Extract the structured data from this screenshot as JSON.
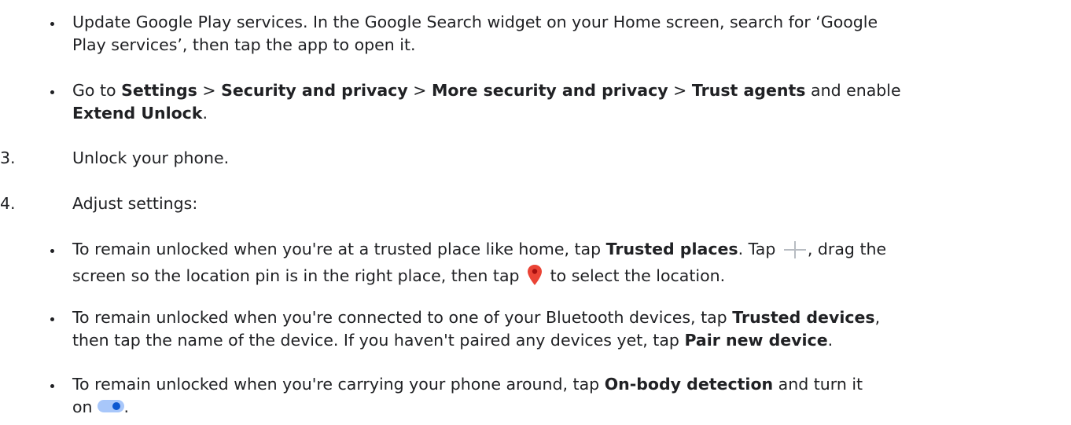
{
  "items": [
    {
      "type": "bullet",
      "lines": [
        "Update Google Play services. In the Google Search widget on your Home screen, search for ‘Google",
        "Play services’, then tap the app to open it."
      ]
    },
    {
      "type": "bullet",
      "settings_intro": "Go to",
      "settings": "Settings",
      "sep": ">",
      "security": "Security and privacy",
      "more_security": "More security and privacy",
      "trust_agents": "Trust agents",
      "and_enable": "and enable",
      "extend_unlock": "Extend Unlock",
      "period": "."
    },
    {
      "type": "numbered",
      "number": "3.",
      "text": "Unlock your phone."
    },
    {
      "type": "numbered",
      "number": "4.",
      "text": "Adjust settings:"
    },
    {
      "type": "bullet",
      "line1_pre": "To remain unlocked when you're at a trusted place like home, tap",
      "trusted_places": "Trusted places",
      "line1_mid": ". Tap",
      "line1_post": ", drag the",
      "line2_pre": "screen so the location pin is in the right place, then tap",
      "line2_post": "to select the location.",
      "icons": [
        "add-icon",
        "location-pin-icon"
      ]
    },
    {
      "type": "bullet",
      "line1_pre": "To remain unlocked when you're connected to one of your Bluetooth devices, tap",
      "trusted_devices": "Trusted devices",
      "comma": ",",
      "line2_pre": "then tap the name of the device. If you haven't paired any devices yet, tap",
      "pair_new_device": "Pair new device",
      "period": "."
    },
    {
      "type": "bullet",
      "line1_pre": "To remain unlocked when you're carrying your phone around, tap",
      "on_body": "On-body detection",
      "line1_post": "and turn it",
      "line2_pre": "on",
      "period": ".",
      "icons": [
        "toggle-on-icon"
      ]
    }
  ],
  "colors": {
    "text": "#202124",
    "pin": "#ea4335",
    "toggle_track": "#a8c7fa",
    "toggle_thumb": "#0b57d0",
    "plus": "#b8bcc2"
  }
}
